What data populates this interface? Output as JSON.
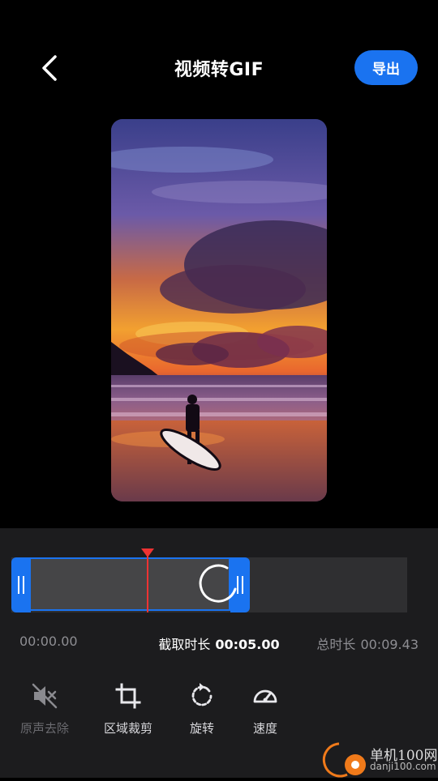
{
  "header": {
    "title": "视频转GIF",
    "export_label": "导出"
  },
  "timeline": {
    "start_time": "00:00.00",
    "clip_label": "截取时长",
    "clip_duration": "00:05.00",
    "total_label": "总时长",
    "total_duration": "00:09.43"
  },
  "tools": [
    {
      "label": "原声去除",
      "icon": "mute-speaker-icon",
      "enabled": false
    },
    {
      "label": "区域裁剪",
      "icon": "crop-icon",
      "enabled": true
    },
    {
      "label": "旋转",
      "icon": "rotate-icon",
      "enabled": true
    },
    {
      "label": "速度",
      "icon": "speedometer-icon",
      "enabled": true
    }
  ],
  "watermark": {
    "name": "单机100网",
    "url": "danji100.com"
  },
  "colors": {
    "accent": "#1a73f0",
    "playhead": "#e33333",
    "panel": "#1c1c1e"
  }
}
